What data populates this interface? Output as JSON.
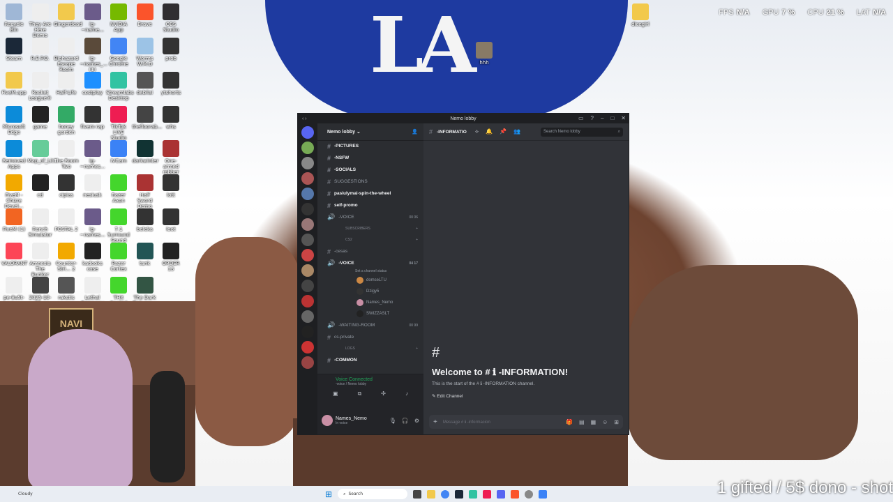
{
  "stats": {
    "fps_label": "FPS",
    "fps": "N/A",
    "gpu_label": "GPU",
    "gpu": "7 %",
    "cpu_label": "CPU",
    "cpu": "21 %",
    "lat_label": "LAT",
    "lat": "N/A"
  },
  "desktop_icons": [
    {
      "label": "Recycle Bin",
      "color": "#9fb7d6"
    },
    {
      "label": "They Are Here Demo",
      "color": "#eee"
    },
    {
      "label": "Gingerdead",
      "color": "#f2c94c"
    },
    {
      "label": "ig-~name...",
      "color": "#6b5b8a"
    },
    {
      "label": "NVIDIA App",
      "color": "#76b900"
    },
    {
      "label": "Brave",
      "color": "#fb542b"
    },
    {
      "label": "OBS Studio",
      "color": "#302e31"
    },
    {
      "label": "Steam",
      "color": "#1b2838"
    },
    {
      "label": "R.E.P.O.",
      "color": "#eee"
    },
    {
      "label": "Biohazard Escape Room",
      "color": "#eee"
    },
    {
      "label": "ig-~names_... (1)",
      "color": "#5a4a3a"
    },
    {
      "label": "Google Chrome",
      "color": "#4285f4"
    },
    {
      "label": "Worms W.M.D",
      "color": "#9cc3e6"
    },
    {
      "label": "prob",
      "color": "#333"
    },
    {
      "label": "FiveM.app",
      "color": "#f2c94c"
    },
    {
      "label": "Rocket League®",
      "color": "#eee"
    },
    {
      "label": "Half-Life",
      "color": "#eee"
    },
    {
      "label": "costplay",
      "color": "#1e90ff"
    },
    {
      "label": "Streamlabs Desktop",
      "color": "#31c3a2"
    },
    {
      "label": "debilai",
      "color": "#555"
    },
    {
      "label": "ytshorts",
      "color": "#333"
    },
    {
      "label": "Microsoft Edge",
      "color": "#0c8bd9"
    },
    {
      "label": "game",
      "color": "#222"
    },
    {
      "label": "honey garden",
      "color": "#3a6"
    },
    {
      "label": "fivem rap",
      "color": "#333"
    },
    {
      "label": "TikTok LIVE Studio",
      "color": "#ee1d52"
    },
    {
      "label": "thefloorab...",
      "color": "#444"
    },
    {
      "label": "whs",
      "color": "#333"
    },
    {
      "label": "Removed Apps",
      "color": "#0c8bd9"
    },
    {
      "label": "Map_of_Lit...",
      "color": "#6c9"
    },
    {
      "label": "The Room Two",
      "color": "#eee"
    },
    {
      "label": "ig-~names...",
      "color": "#6b5b8a"
    },
    {
      "label": "IVCam",
      "color": "#3b82f6"
    },
    {
      "label": "darkwinter",
      "color": "#133"
    },
    {
      "label": "One-armed robber",
      "color": "#a33"
    },
    {
      "label": "FiveM - Chizre Devel...",
      "color": "#f2a900"
    },
    {
      "label": "cd",
      "color": "#222"
    },
    {
      "label": "cipias",
      "color": "#333"
    },
    {
      "label": "nesiusk",
      "color": "#eee"
    },
    {
      "label": "Razer Axon",
      "color": "#44d62c"
    },
    {
      "label": "Half Sword Demo",
      "color": "#a33"
    },
    {
      "label": "lott",
      "color": "#333"
    },
    {
      "label": "FiveM (1)",
      "color": "#f26522"
    },
    {
      "label": "Ranch Simulator",
      "color": "#eee"
    },
    {
      "label": "POSTAL 2",
      "color": "#eee"
    },
    {
      "label": "ig-~names...",
      "color": "#6b5b8a"
    },
    {
      "label": "7.1 Surround Sound",
      "color": "#44d62c"
    },
    {
      "label": "beleka",
      "color": "#333"
    },
    {
      "label": "loot",
      "color": "#333"
    },
    {
      "label": "VALORANT",
      "color": "#fd4556"
    },
    {
      "label": "Amnesia The Bunker",
      "color": "#eee"
    },
    {
      "label": "Counter-Stri... 2",
      "color": "#f2a900"
    },
    {
      "label": "kadooks case",
      "color": "#222"
    },
    {
      "label": "Razer Cortex",
      "color": "#44d62c"
    },
    {
      "label": "tank",
      "color": "#255"
    },
    {
      "label": "ORDER 13",
      "color": "#222"
    },
    {
      "label": "pe-8u5t-w...",
      "color": "#eee"
    },
    {
      "label": "2025-10-08...",
      "color": "#444"
    },
    {
      "label": "rakstis",
      "color": "#555"
    },
    {
      "label": "Lethal Company",
      "color": "#eee"
    },
    {
      "label": "THX Spatial Audio",
      "color": "#44d62c"
    },
    {
      "label": "The Dark Pictures...",
      "color": "#354"
    },
    {
      "label": "",
      "color": "transparent"
    }
  ],
  "right_icons": [
    {
      "label": "dicegirl",
      "color": "#f2c94c"
    },
    {
      "label": "hhh",
      "color": "#887a66"
    }
  ],
  "webcam": {
    "sign": "NAVI"
  },
  "discord": {
    "window_title": "Nemo lobby",
    "server_name": "Nemo lobby",
    "channels": [
      {
        "kind": "text",
        "name": "-PICTURES",
        "bright": true
      },
      {
        "kind": "text",
        "name": "-NSFW",
        "bright": true
      },
      {
        "kind": "text",
        "name": "-SOCIALS",
        "bright": true
      },
      {
        "kind": "text",
        "name": "SUGGESTIONS",
        "bright": false
      },
      {
        "kind": "text",
        "name": "pasiulymai-spin-the-wheel",
        "bright": true
      },
      {
        "kind": "text",
        "name": "self-promo",
        "bright": true
      },
      {
        "kind": "voice",
        "name": "-VOICE",
        "bright": false,
        "right": "00  06"
      }
    ],
    "category_subscribers": "SUBSCRIBERS",
    "category_cs2": "CS2",
    "channels2": [
      {
        "kind": "text",
        "name": "-cesas",
        "bright": false
      },
      {
        "kind": "voice",
        "name": "-VOICE",
        "bright": true,
        "right": "04  17"
      }
    ],
    "voice_status": "Set a channel status",
    "voice_users": [
      {
        "name": "domseLTU",
        "color": "#c84"
      },
      {
        "name": "Dzigy5",
        "color": "#333"
      },
      {
        "name": "Names_Nemo",
        "color": "#c98fa5"
      },
      {
        "name": "SWIZZASLT",
        "color": "#222"
      }
    ],
    "channels3": [
      {
        "kind": "voice",
        "name": "-WAITING-ROOM",
        "bright": false,
        "right": "00  99"
      },
      {
        "kind": "text",
        "name": "cs-private",
        "bright": false
      }
    ],
    "category_logs": "LOGS",
    "channels4": [
      {
        "kind": "text",
        "name": "-COMMON",
        "bright": true
      }
    ],
    "voice_connected": "Voice Connected",
    "voice_location": "-voice / Nemo lobby",
    "username": "Names_Nemo",
    "user_status": "In voice",
    "current_channel": "-INFORMATIO",
    "search_placeholder": "Search Nemo lobby",
    "welcome_title": "Welcome to # ℹ -INFORMATION!",
    "welcome_sub": "This is the start of the # ℹ -INFORMATION channel.",
    "edit_channel": "Edit Channel",
    "composer_placeholder": "Message # ℹ -informacion"
  },
  "taskbar": {
    "weather": "Cloudy",
    "search": "Search"
  },
  "overlay_text": "1 gifted / 5$ dono - shot"
}
